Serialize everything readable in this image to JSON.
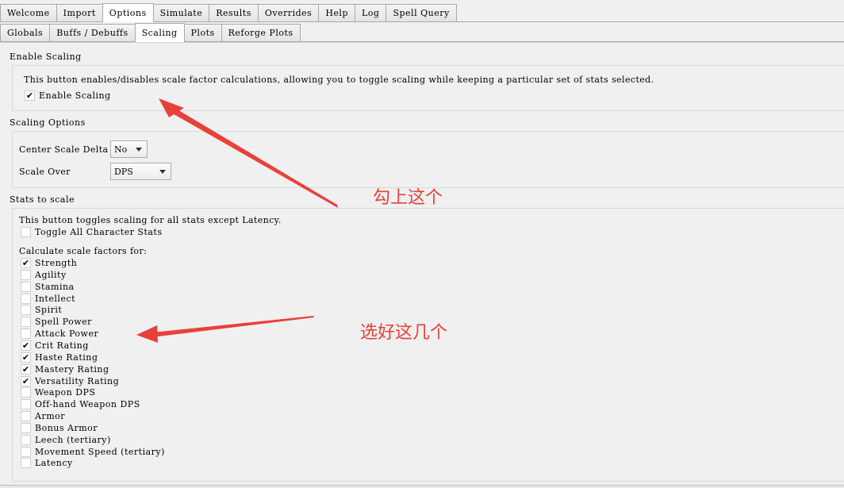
{
  "main_tabs": [
    "Welcome",
    "Import",
    "Options",
    "Simulate",
    "Results",
    "Overrides",
    "Help",
    "Log",
    "Spell Query"
  ],
  "main_tab_active": "Options",
  "sub_tabs": [
    "Globals",
    "Buffs / Debuffs",
    "Scaling",
    "Plots",
    "Reforge Plots"
  ],
  "sub_tab_active": "Scaling",
  "enable_scaling": {
    "title": "Enable Scaling",
    "description": "This button enables/disables scale factor calculations, allowing you to toggle scaling while keeping a particular set of stats selected.",
    "checkbox_label": "Enable Scaling",
    "checked": true
  },
  "scaling_options": {
    "title": "Scaling Options",
    "center_label": "Center Scale Delta",
    "center_value": "No",
    "scale_over_label": "Scale Over",
    "scale_over_value": "DPS"
  },
  "stats": {
    "title": "Stats to scale",
    "toggle_desc": "This button toggles scaling for all stats except Latency.",
    "toggle_label": "Toggle All Character Stats",
    "calc_label": "Calculate scale factors for:",
    "items": [
      {
        "label": "Strength",
        "checked": true
      },
      {
        "label": "Agility",
        "checked": false
      },
      {
        "label": "Stamina",
        "checked": false
      },
      {
        "label": "Intellect",
        "checked": false
      },
      {
        "label": "Spirit",
        "checked": false
      },
      {
        "label": "Spell Power",
        "checked": false
      },
      {
        "label": "Attack Power",
        "checked": false
      },
      {
        "label": "Crit Rating",
        "checked": true
      },
      {
        "label": "Haste Rating",
        "checked": true
      },
      {
        "label": "Mastery Rating",
        "checked": true
      },
      {
        "label": "Versatility Rating",
        "checked": true
      },
      {
        "label": "Weapon DPS",
        "checked": false
      },
      {
        "label": "Off-hand Weapon DPS",
        "checked": false
      },
      {
        "label": "Armor",
        "checked": false
      },
      {
        "label": "Bonus Armor",
        "checked": false
      },
      {
        "label": "Leech (tertiary)",
        "checked": false
      },
      {
        "label": "Movement Speed (tertiary)",
        "checked": false
      },
      {
        "label": "Latency",
        "checked": false
      }
    ]
  },
  "annotations": {
    "top": "勾上这个",
    "bottom": "选好这几个",
    "color": "#e8413a"
  }
}
